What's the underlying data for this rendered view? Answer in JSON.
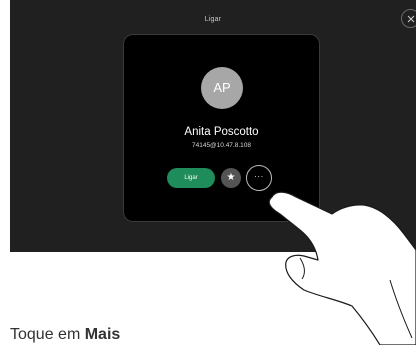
{
  "screen": {
    "title": "Ligar"
  },
  "card": {
    "avatar_initials": "AP",
    "contact_name": "Anita Poscotto",
    "contact_address": "74145@10.47.8.108",
    "call_label": "Ligar",
    "favorite_icon": "star-icon",
    "more_icon": "ellipsis-icon",
    "more_glyph": "···"
  },
  "caption": {
    "prefix": "Toque em ",
    "emphasis": "Mais"
  },
  "colors": {
    "screen_bg": "#202020",
    "card_bg": "#000000",
    "call_button": "#1f8c5c",
    "avatar": "#a7a7a7"
  }
}
